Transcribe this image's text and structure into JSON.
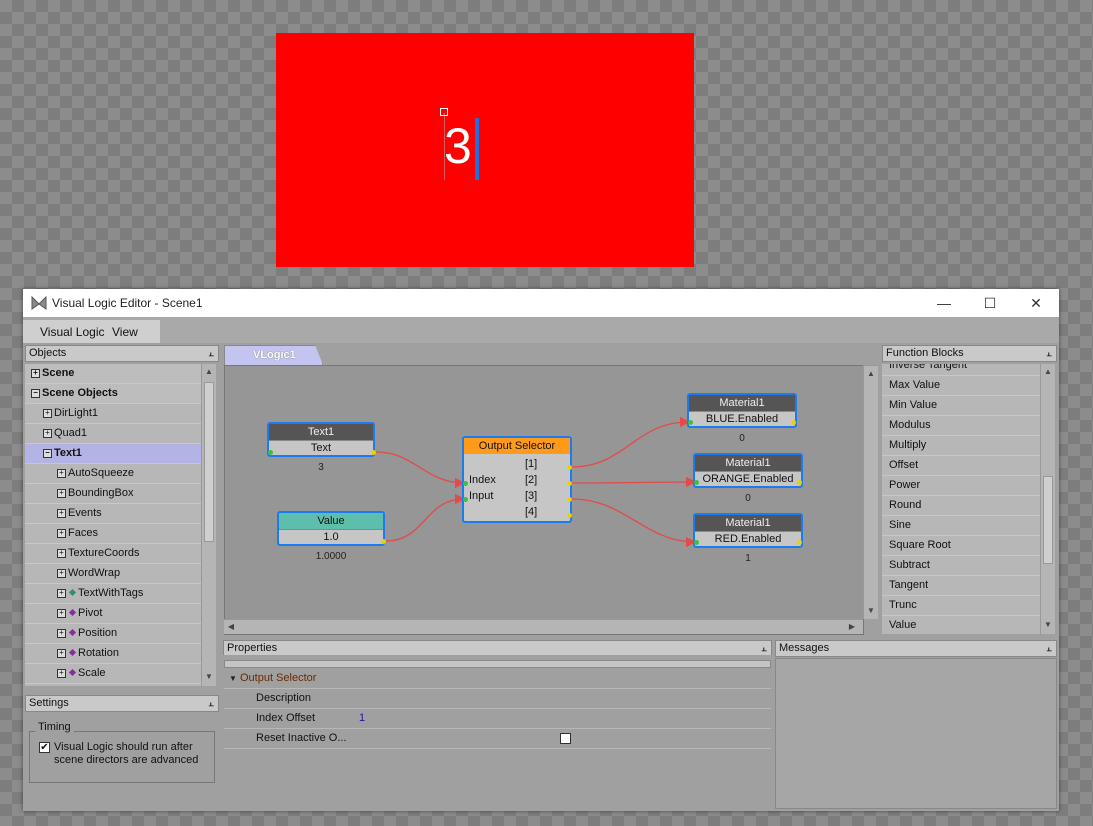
{
  "viewport": {
    "display_text": "3",
    "background": "#ff0000",
    "text_color": "#ffffff"
  },
  "window": {
    "title": "Visual Logic Editor - Scene1",
    "minimize": "—",
    "maximize": "☐",
    "close": "✕"
  },
  "menu": {
    "items": [
      "Visual Logic",
      "View"
    ]
  },
  "objects_panel": {
    "title": "Objects",
    "pin": "📌",
    "items": [
      {
        "label": "Scene",
        "expander": "+"
      },
      {
        "label": "Scene Objects",
        "expander": "−"
      },
      {
        "label": "DirLight1",
        "expander": "+"
      },
      {
        "label": "Quad1",
        "expander": "+"
      },
      {
        "label": "Text1",
        "expander": "−"
      },
      {
        "label": "AutoSqueeze",
        "expander": "+"
      },
      {
        "label": "BoundingBox",
        "expander": "+"
      },
      {
        "label": "Events",
        "expander": "+"
      },
      {
        "label": "Faces",
        "expander": "+"
      },
      {
        "label": "TextureCoords",
        "expander": "+"
      },
      {
        "label": "WordWrap",
        "expander": "+"
      },
      {
        "label": "TextWithTags",
        "expander": "+"
      },
      {
        "label": "Pivot",
        "expander": "+"
      },
      {
        "label": "Position",
        "expander": "+"
      },
      {
        "label": "Rotation",
        "expander": "+"
      },
      {
        "label": "Scale",
        "expander": "+"
      }
    ]
  },
  "settings_panel": {
    "title": "Settings",
    "group_label": "Timing",
    "checkbox_checked": true,
    "check_glyph": "✔",
    "checkbox_label": "Visual Logic should run after scene directors are advanced"
  },
  "graph": {
    "tab": "VLogic1",
    "nodes": {
      "text1": {
        "title": "Text1",
        "row": "Text",
        "caption": "3"
      },
      "value": {
        "title": "Value",
        "row": "1.0",
        "caption": "1.0000"
      },
      "output_selector": {
        "title": "Output Selector",
        "inputs": [
          "Index",
          "Input"
        ],
        "outputs": [
          "[1]",
          "[2]",
          "[3]",
          "[4]"
        ]
      },
      "mat_blue": {
        "title": "Material1",
        "row": "BLUE.Enabled",
        "caption": "0"
      },
      "mat_orange": {
        "title": "Material1",
        "row": "ORANGE.Enabled",
        "caption": "0"
      },
      "mat_red": {
        "title": "Material1",
        "row": "RED.Enabled",
        "caption": "1"
      }
    }
  },
  "function_blocks": {
    "title": "Function Blocks",
    "items": [
      "Inverse Tangent",
      "Max Value",
      "Min Value",
      "Modulus",
      "Multiply",
      "Offset",
      "Power",
      "Round",
      "Sine",
      "Square Root",
      "Subtract",
      "Tangent",
      "Trunc",
      "Value"
    ]
  },
  "properties": {
    "title": "Properties",
    "group": "Output Selector",
    "rows": [
      {
        "label": "Description",
        "value": ""
      },
      {
        "label": "Index Offset",
        "value": "1"
      },
      {
        "label": "Reset Inactive O...",
        "value": ""
      }
    ]
  },
  "messages": {
    "title": "Messages"
  },
  "scroll_glyphs": {
    "up": "▲",
    "down": "▼",
    "left": "◀",
    "right": "▶"
  },
  "colors": {
    "accent": "#1b7cf2",
    "link": "#e34a4a",
    "value_node": "#5ebeac",
    "selector_node": "#ff9a1a",
    "selection": "#b3b3e6"
  }
}
